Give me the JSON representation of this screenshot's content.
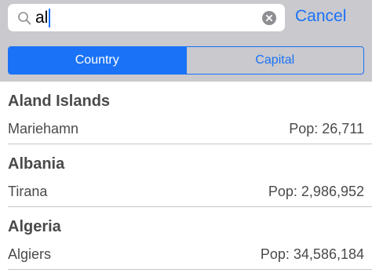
{
  "search": {
    "query": "al",
    "cancel_label": "Cancel",
    "icon": "search-icon",
    "clear_icon": "clear-icon"
  },
  "scope": {
    "segments": [
      {
        "label": "Country",
        "selected": true
      },
      {
        "label": "Capital",
        "selected": false
      }
    ]
  },
  "results": [
    {
      "country": "Aland Islands",
      "capital": "Mariehamn",
      "population": "Pop: 26,711"
    },
    {
      "country": "Albania",
      "capital": "Tirana",
      "population": "Pop: 2,986,952"
    },
    {
      "country": "Algeria",
      "capital": "Algiers",
      "population": "Pop: 34,586,184"
    }
  ],
  "colors": {
    "accent": "#1a72f6",
    "search_bar_background": "#c9c9ce",
    "text": "#4a4a4a",
    "separator": "#c8c7cc"
  }
}
